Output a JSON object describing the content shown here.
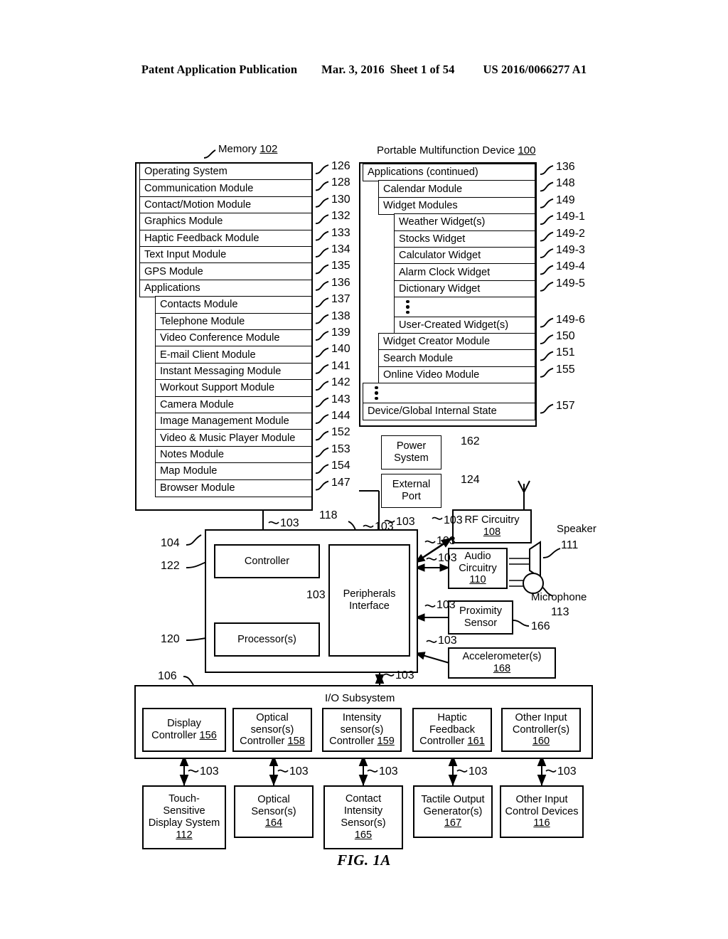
{
  "header": {
    "publication": "Patent Application Publication",
    "date": "Mar. 3, 2016",
    "sheet": "Sheet 1 of 54",
    "patent_number": "US 2016/0066277 A1"
  },
  "figure_caption": "FIG. 1A",
  "memory": {
    "title": "Memory",
    "title_ref": "102",
    "rows": [
      {
        "label": "Operating System",
        "ref": "126",
        "indent": 0
      },
      {
        "label": "Communication Module",
        "ref": "128",
        "indent": 0
      },
      {
        "label": "Contact/Motion Module",
        "ref": "130",
        "indent": 0
      },
      {
        "label": "Graphics Module",
        "ref": "132",
        "indent": 0
      },
      {
        "label": "Haptic Feedback Module",
        "ref": "133",
        "indent": 0
      },
      {
        "label": "Text Input Module",
        "ref": "134",
        "indent": 0
      },
      {
        "label": "GPS Module",
        "ref": "135",
        "indent": 0
      },
      {
        "label": "Applications",
        "ref": "136",
        "indent": 0
      },
      {
        "label": "Contacts Module",
        "ref": "137",
        "indent": 1
      },
      {
        "label": "Telephone Module",
        "ref": "138",
        "indent": 1
      },
      {
        "label": "Video Conference Module",
        "ref": "139",
        "indent": 1
      },
      {
        "label": "E-mail Client Module",
        "ref": "140",
        "indent": 1
      },
      {
        "label": "Instant Messaging Module",
        "ref": "141",
        "indent": 1
      },
      {
        "label": "Workout Support Module",
        "ref": "142",
        "indent": 1
      },
      {
        "label": "Camera Module",
        "ref": "143",
        "indent": 1
      },
      {
        "label": "Image Management Module",
        "ref": "144",
        "indent": 1
      },
      {
        "label": "Video & Music Player Module",
        "ref": "152",
        "indent": 1
      },
      {
        "label": "Notes Module",
        "ref": "153",
        "indent": 1
      },
      {
        "label": "Map Module",
        "ref": "154",
        "indent": 1
      },
      {
        "label": "Browser Module",
        "ref": "147",
        "indent": 1
      }
    ]
  },
  "device": {
    "title": "Portable Multifunction Device",
    "title_ref": "100",
    "rows": [
      {
        "label": "Applications (continued)",
        "ref": "136",
        "indent": 0
      },
      {
        "label": "Calendar Module",
        "ref": "148",
        "indent": 1
      },
      {
        "label": "Widget Modules",
        "ref": "149",
        "indent": 1
      },
      {
        "label": "Weather Widget(s)",
        "ref": "149-1",
        "indent": 2
      },
      {
        "label": "Stocks Widget",
        "ref": "149-2",
        "indent": 2
      },
      {
        "label": "Calculator Widget",
        "ref": "149-3",
        "indent": 2
      },
      {
        "label": "Alarm Clock Widget",
        "ref": "149-4",
        "indent": 2
      },
      {
        "label": "Dictionary Widget",
        "ref": "149-5",
        "indent": 2
      },
      {
        "label": "",
        "ref": "",
        "indent": 2,
        "ellipsis": true
      },
      {
        "label": "User-Created Widget(s)",
        "ref": "149-6",
        "indent": 2
      },
      {
        "label": "Widget Creator Module",
        "ref": "150",
        "indent": 1
      },
      {
        "label": "Search Module",
        "ref": "151",
        "indent": 1
      },
      {
        "label": "Online Video Module",
        "ref": "155",
        "indent": 1
      },
      {
        "label": "",
        "ref": "",
        "indent": 0,
        "ellipsis": true
      },
      {
        "label": "Device/Global Internal State",
        "ref": "157",
        "indent": 0
      }
    ]
  },
  "blocks": {
    "power_system": {
      "line1": "Power",
      "line2": "System",
      "ref": "162"
    },
    "external_port": {
      "line1": "External",
      "line2": "Port",
      "ref": "124"
    },
    "rf_circuitry": {
      "line1": "RF Circuitry",
      "ref": "108"
    },
    "audio_circuitry": {
      "line1": "Audio",
      "line2": "Circuitry",
      "ref": "110"
    },
    "proximity_sensor": {
      "line1": "Proximity",
      "line2": "Sensor",
      "ref": "166"
    },
    "accelerometer": {
      "line1": "Accelerometer(s)",
      "ref": "168"
    },
    "speaker": {
      "label": "Speaker",
      "ref": "111"
    },
    "microphone": {
      "label": "Microphone",
      "ref": "113"
    },
    "controller": {
      "label": "Controller",
      "ref": "122"
    },
    "processors": {
      "label": "Processor(s)",
      "ref": "120"
    },
    "peripherals_interface": {
      "line1": "Peripherals",
      "line2": "Interface",
      "ref": "118"
    },
    "cpu_group_ref": "104",
    "io_subsystem": {
      "label": "I/O Subsystem",
      "ref": "106"
    }
  },
  "io_controllers": [
    {
      "lines": [
        "Display",
        "Controller"
      ],
      "ref": "156"
    },
    {
      "lines": [
        "Optical",
        "sensor(s)",
        "Controller"
      ],
      "ref": "158"
    },
    {
      "lines": [
        "Intensity",
        "sensor(s)",
        "Controller"
      ],
      "ref": "159"
    },
    {
      "lines": [
        "Haptic",
        "Feedback",
        "Controller"
      ],
      "ref": "161"
    },
    {
      "lines": [
        "Other Input",
        "Controller(s)"
      ],
      "ref": "160"
    }
  ],
  "io_devices": [
    {
      "lines": [
        "Touch-",
        "Sensitive",
        "Display System"
      ],
      "ref": "112"
    },
    {
      "lines": [
        "Optical",
        "Sensor(s)"
      ],
      "ref": "164"
    },
    {
      "lines": [
        "Contact",
        "Intensity",
        "Sensor(s)"
      ],
      "ref": "165"
    },
    {
      "lines": [
        "Tactile Output",
        "Generator(s)"
      ],
      "ref": "167"
    },
    {
      "lines": [
        "Other Input",
        "Control Devices"
      ],
      "ref": "116"
    }
  ],
  "bus_label": "103",
  "bus_labels": {
    "mem_to_cpu": "103",
    "port_to_periph": "103",
    "cpu_internal": "103",
    "rf": "103",
    "audio": "103",
    "proximity": "103",
    "accel": "103",
    "to_io": "103",
    "dev_1": "103",
    "dev_2": "103",
    "dev_3": "103",
    "dev_4": "103",
    "dev_5": "103"
  }
}
